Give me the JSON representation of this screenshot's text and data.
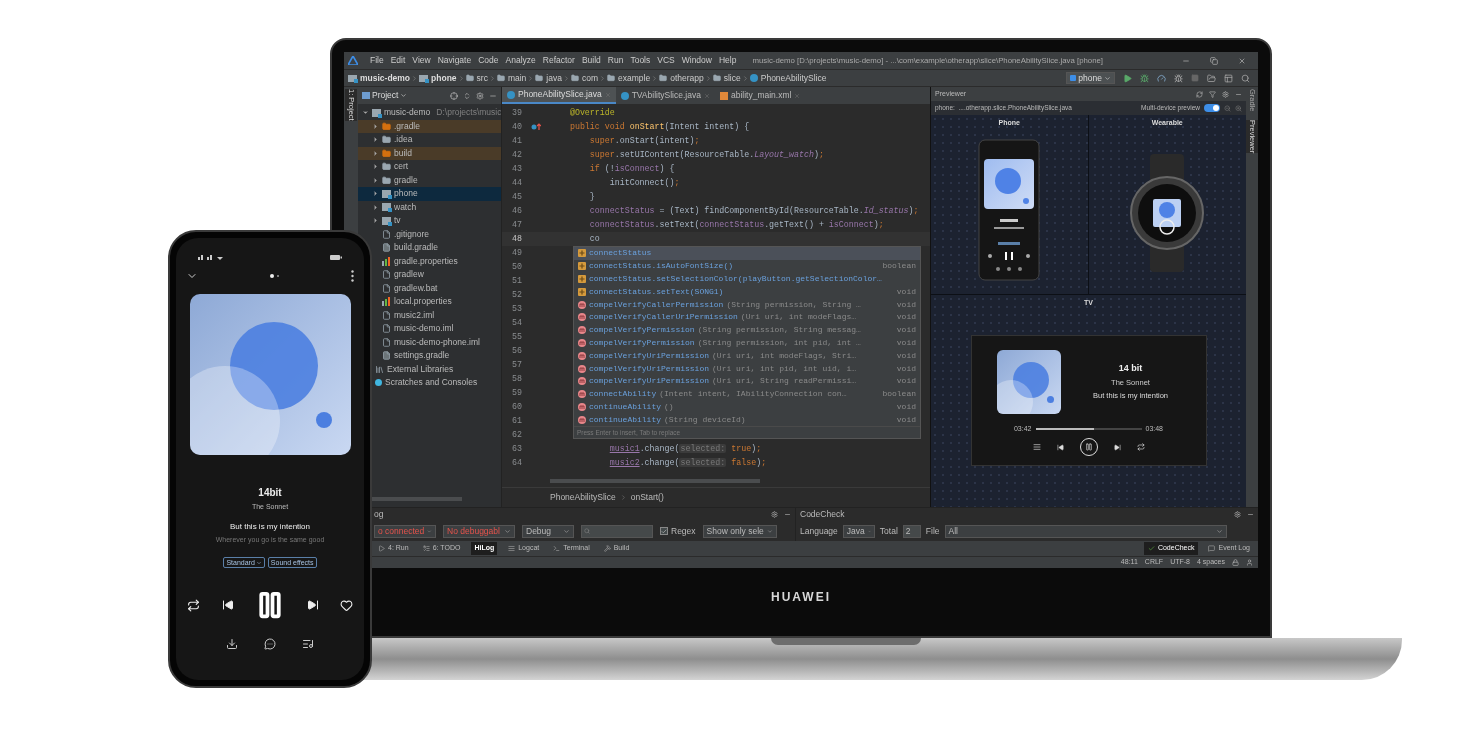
{
  "window": {
    "title": "music-demo [D:\\projects\\music-demo] - ...\\com\\example\\otherapp\\slice\\PhoneAbilitySlice.java [phone]"
  },
  "menu": [
    "File",
    "Edit",
    "View",
    "Navigate",
    "Code",
    "Analyze",
    "Refactor",
    "Build",
    "Run",
    "Tools",
    "VCS",
    "Window",
    "Help"
  ],
  "breadcrumbs": [
    {
      "label": "music-demo",
      "kind": "module"
    },
    {
      "label": "phone",
      "kind": "module"
    },
    {
      "label": "src",
      "kind": "folder"
    },
    {
      "label": "main",
      "kind": "folder"
    },
    {
      "label": "java",
      "kind": "folder"
    },
    {
      "label": "com",
      "kind": "folder"
    },
    {
      "label": "example",
      "kind": "folder"
    },
    {
      "label": "otherapp",
      "kind": "folder"
    },
    {
      "label": "slice",
      "kind": "folder"
    },
    {
      "label": "PhoneAbilitySlice",
      "kind": "class"
    }
  ],
  "device_selector": "phone",
  "left_side_tabs": [
    {
      "label": "1: Project",
      "selected": true
    }
  ],
  "project_panel": {
    "title": "Project",
    "tree": [
      {
        "label": "music-demo",
        "path": "D:\\projects\\music",
        "kind": "module",
        "expanded": true,
        "selected": false,
        "children": [
          {
            "label": ".gradle",
            "kind": "excluded",
            "expanded": false,
            "selected": false
          },
          {
            "label": ".idea",
            "kind": "folder",
            "expanded": false,
            "selected": false
          },
          {
            "label": "build",
            "kind": "excluded",
            "expanded": false,
            "selected": false
          },
          {
            "label": "cert",
            "kind": "folder",
            "expanded": false,
            "selected": false
          },
          {
            "label": "gradle",
            "kind": "folder",
            "expanded": false,
            "selected": false
          },
          {
            "label": "phone",
            "kind": "module",
            "expanded": false,
            "selected": true
          },
          {
            "label": "watch",
            "kind": "module",
            "expanded": false,
            "selected": false
          },
          {
            "label": "tv",
            "kind": "module",
            "expanded": false,
            "selected": false
          },
          {
            "label": ".gitignore",
            "kind": "file",
            "selected": false
          },
          {
            "label": "build.gradle",
            "kind": "gradle",
            "selected": false
          },
          {
            "label": "gradle.properties",
            "kind": "properties",
            "selected": false
          },
          {
            "label": "gradlew",
            "kind": "file",
            "selected": false
          },
          {
            "label": "gradlew.bat",
            "kind": "file",
            "selected": false
          },
          {
            "label": "local.properties",
            "kind": "properties",
            "selected": false
          },
          {
            "label": "music2.iml",
            "kind": "file",
            "selected": false
          },
          {
            "label": "music-demo.iml",
            "kind": "file",
            "selected": false
          },
          {
            "label": "music-demo-phone.iml",
            "kind": "file",
            "selected": false
          },
          {
            "label": "settings.gradle",
            "kind": "gradle",
            "selected": false
          }
        ]
      },
      {
        "label": "External Libraries",
        "kind": "library",
        "selected": false
      },
      {
        "label": "Scratches and Consoles",
        "kind": "scratches",
        "selected": false
      }
    ]
  },
  "editor_tabs": [
    {
      "label": "PhoneAbilitySlice.java",
      "kind": "class",
      "selected": true
    },
    {
      "label": "TVAbilitySlice.java",
      "kind": "class",
      "selected": false
    },
    {
      "label": "ability_main.xml",
      "kind": "xml",
      "selected": false
    }
  ],
  "code_lines": [
    {
      "number": "39",
      "override_mark": false,
      "current": false,
      "tokens": [
        {
          "kind": "annotation",
          "text": "    @Override"
        }
      ]
    },
    {
      "number": "40",
      "override_mark": true,
      "current": false,
      "tokens": [
        {
          "kind": "keyword",
          "text": "    public void "
        },
        {
          "kind": "method",
          "text": "onStart"
        },
        {
          "kind": "plain",
          "text": "(Intent intent) {"
        }
      ]
    },
    {
      "number": "41",
      "override_mark": false,
      "current": false,
      "tokens": [
        {
          "kind": "keyword",
          "text": "        super"
        },
        {
          "kind": "plain",
          "text": ".onStart(intent)"
        },
        {
          "kind": "keyword",
          "text": ";"
        }
      ]
    },
    {
      "number": "42",
      "override_mark": false,
      "current": false,
      "tokens": [
        {
          "kind": "keyword",
          "text": "        super"
        },
        {
          "kind": "plain",
          "text": ".setUIContent(ResourceTable."
        },
        {
          "kind": "constant",
          "text": "Layout_watch"
        },
        {
          "kind": "plain",
          "text": ")"
        },
        {
          "kind": "keyword",
          "text": ";"
        }
      ]
    },
    {
      "number": "43",
      "override_mark": false,
      "current": false,
      "tokens": [
        {
          "kind": "keyword",
          "text": "        if "
        },
        {
          "kind": "plain",
          "text": "(!"
        },
        {
          "kind": "field",
          "text": "isConnect"
        },
        {
          "kind": "plain",
          "text": ") {"
        }
      ]
    },
    {
      "number": "44",
      "override_mark": false,
      "current": false,
      "tokens": [
        {
          "kind": "plain",
          "text": "            initConnect()"
        },
        {
          "kind": "keyword",
          "text": ";"
        }
      ]
    },
    {
      "number": "45",
      "override_mark": false,
      "current": false,
      "tokens": [
        {
          "kind": "plain",
          "text": "        }"
        }
      ]
    },
    {
      "number": "46",
      "override_mark": false,
      "current": false,
      "tokens": [
        {
          "kind": "field",
          "text": "        connectStatus"
        },
        {
          "kind": "plain",
          "text": " = (Text) findComponentById(ResourceTable."
        },
        {
          "kind": "constant",
          "text": "Id_status"
        },
        {
          "kind": "plain",
          "text": ")"
        },
        {
          "kind": "keyword",
          "text": ";"
        }
      ]
    },
    {
      "number": "47",
      "override_mark": false,
      "current": false,
      "tokens": [
        {
          "kind": "field",
          "text": "        connectStatus"
        },
        {
          "kind": "plain",
          "text": ".setText("
        },
        {
          "kind": "field",
          "text": "connectStatus"
        },
        {
          "kind": "plain",
          "text": ".getText() + "
        },
        {
          "kind": "field",
          "text": "isConnect"
        },
        {
          "kind": "plain",
          "text": ")"
        },
        {
          "kind": "keyword",
          "text": ";"
        }
      ]
    },
    {
      "number": "48",
      "override_mark": false,
      "current": true,
      "tokens": [
        {
          "kind": "plain",
          "text": "        co"
        }
      ]
    },
    {
      "number": "49",
      "override_mark": false,
      "current": false
    },
    {
      "number": "50",
      "override_mark": false,
      "current": false
    },
    {
      "number": "51",
      "override_mark": false,
      "current": false
    },
    {
      "number": "52",
      "override_mark": false,
      "current": false
    },
    {
      "number": "53",
      "override_mark": false,
      "current": false
    },
    {
      "number": "54",
      "override_mark": false,
      "current": false
    },
    {
      "number": "55",
      "override_mark": false,
      "current": false
    },
    {
      "number": "56",
      "override_mark": false,
      "current": false
    },
    {
      "number": "57",
      "override_mark": false,
      "current": false
    },
    {
      "number": "58",
      "override_mark": false,
      "current": false
    },
    {
      "number": "59",
      "override_mark": false,
      "current": false
    },
    {
      "number": "60",
      "override_mark": false,
      "current": false
    },
    {
      "number": "61",
      "override_mark": false,
      "current": false
    },
    {
      "number": "62",
      "override_mark": false,
      "current": false
    },
    {
      "number": "63",
      "override_mark": false,
      "current": false,
      "tokens": [
        {
          "kind": "link",
          "text": "            music1"
        },
        {
          "kind": "plain",
          "text": ".change("
        },
        {
          "kind": "hint",
          "text": "selected:"
        },
        {
          "kind": "keyword",
          "text": " true"
        },
        {
          "kind": "plain",
          "text": ")"
        },
        {
          "kind": "keyword",
          "text": ";"
        }
      ]
    },
    {
      "number": "64",
      "override_mark": false,
      "current": false,
      "tokens": [
        {
          "kind": "link",
          "text": "            music2"
        },
        {
          "kind": "plain",
          "text": ".change("
        },
        {
          "kind": "hint",
          "text": "selected:"
        },
        {
          "kind": "keyword",
          "text": " false"
        },
        {
          "kind": "plain",
          "text": ")"
        },
        {
          "kind": "keyword",
          "text": ";"
        }
      ]
    }
  ],
  "completion": {
    "items": [
      {
        "kind": "field",
        "name": "connectStatus",
        "selected": true
      },
      {
        "kind": "field",
        "name": "connectStatus.isAutoFontSize()",
        "type": "boolean",
        "selected": false
      },
      {
        "kind": "field",
        "name": "connectStatus.setSelectionColor(playButton.getSelectionColor…",
        "selected": false
      },
      {
        "kind": "field",
        "name": "connectStatus.setText(SONG1)",
        "type": "void",
        "selected": false
      },
      {
        "kind": "method",
        "name": "compelVerifyCallerPermission",
        "params": "(String permission, String …",
        "type": "void",
        "selected": false
      },
      {
        "kind": "method",
        "name": "compelVerifyCallerUriPermission",
        "params": "(Uri uri, int modeFlags…",
        "type": "void",
        "selected": false
      },
      {
        "kind": "method",
        "name": "compelVerifyPermission",
        "params": "(String permission, String messag…",
        "type": "void",
        "selected": false
      },
      {
        "kind": "method",
        "name": "compelVerifyPermission",
        "params": "(String permission, int pid, int …",
        "type": "void",
        "selected": false
      },
      {
        "kind": "method",
        "name": "compelVerifyUriPermission",
        "params": "(Uri uri, int modeFlags, Stri…",
        "type": "void",
        "selected": false
      },
      {
        "kind": "method",
        "name": "compelVerifyUriPermission",
        "params": "(Uri uri, int pid, int uid, i…",
        "type": "void",
        "selected": false
      },
      {
        "kind": "method",
        "name": "compelVerifyUriPermission",
        "params": "(Uri uri, String readPermissi…",
        "type": "void",
        "selected": false
      },
      {
        "kind": "method",
        "name": "connectAbility",
        "params": "(Intent intent, IAbilityConnection con…",
        "type": "boolean",
        "selected": false
      },
      {
        "kind": "method",
        "name": "continueAbility",
        "params": "()",
        "type": "void",
        "selected": false
      },
      {
        "kind": "method",
        "name": "continueAbility",
        "params": "(String deviceId)",
        "type": "void",
        "selected": false
      }
    ],
    "hint": "Press Enter to insert, Tab to replace"
  },
  "editor_breadcrumb": [
    "PhoneAbilitySlice",
    "onStart()"
  ],
  "previewer": {
    "title": "Previewer",
    "file": "phone:  ....otherapp.slice.PhoneAbilitySlice.java",
    "multi_device": {
      "label": "Multi-device preview",
      "on": true
    },
    "devices": [
      {
        "label": "Phone",
        "kind": "phone"
      },
      {
        "label": "Wearable",
        "kind": "watch"
      }
    ],
    "tv": {
      "label": "TV",
      "title": "14 bit",
      "artist": "The Sonnet",
      "lyric": "But this is my intention",
      "elapsed": "03:42",
      "total": "03:48",
      "level": 0.55
    }
  },
  "right_side_tabs": [
    {
      "label": "Gradle",
      "selected": false
    },
    {
      "label": "Previewer",
      "selected": true
    }
  ],
  "hilog": {
    "title": "og",
    "device": "o connected",
    "process": "No debuggabl",
    "log_level": "Debug",
    "regex": {
      "label": "Regex",
      "checked": true
    },
    "filter": "Show only sele"
  },
  "codecheck": {
    "title": "CodeCheck",
    "language_label": "Language",
    "language": "Java",
    "total_label": "Total",
    "total": "2",
    "file_label": "File",
    "file": "All"
  },
  "tool_tabs_left": [
    {
      "label": "4: Run",
      "kind": "run",
      "selected": false
    },
    {
      "label": "6: TODO",
      "kind": "todo",
      "selected": false
    },
    {
      "label": "HiLog",
      "kind": "none",
      "selected": true
    },
    {
      "label": "Logcat",
      "kind": "log",
      "selected": false
    },
    {
      "label": "Terminal",
      "kind": "terminal",
      "selected": false
    },
    {
      "label": "Build",
      "kind": "build",
      "selected": false
    }
  ],
  "tool_tabs_right": [
    {
      "label": "CodeCheck",
      "kind": "check",
      "selected": true
    },
    {
      "label": "Event Log",
      "kind": "event",
      "selected": false
    }
  ],
  "status_bar": [
    "48:11",
    "CRLF",
    "UTF-8",
    "4 spaces"
  ],
  "laptop": {
    "brand": "HUAWEI"
  },
  "phone": {
    "title": "14bit",
    "artist": "The Sonnet",
    "lyric": "But this is my intention",
    "next_lyric": "Wherever you go is the same good",
    "tags": [
      "Standard",
      "Sound effects"
    ]
  }
}
